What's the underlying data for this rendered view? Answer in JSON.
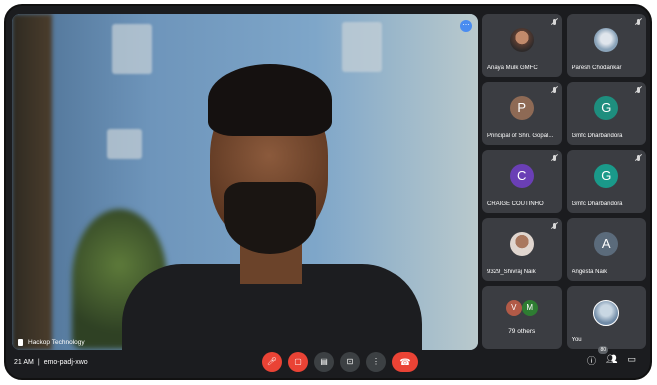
{
  "stage": {
    "presenter_name": "Hackop Technology",
    "more_icon": "more-icon"
  },
  "tiles": [
    {
      "name": "Anaya Mulk GMFC",
      "avatar_type": "photo"
    },
    {
      "name": "Paresh Chodankar",
      "avatar_type": "photo2"
    },
    {
      "name": "Principal of Shri. Gopal...",
      "avatar_type": "letter",
      "letter": "P",
      "color": "#8e6a55"
    },
    {
      "name": "Gmfc Dharbandora",
      "avatar_type": "letter",
      "letter": "G",
      "color": "#1e8e7e"
    },
    {
      "name": "CRAIGE COUTINHO",
      "avatar_type": "letter",
      "letter": "C",
      "color": "#6a3fb5"
    },
    {
      "name": "Gmfc Dharbandora",
      "avatar_type": "letter",
      "letter": "G",
      "color": "#1a9a8a"
    },
    {
      "name": "9329_Shivraj Naik",
      "avatar_type": "photo3"
    },
    {
      "name": "Angesta Naik",
      "avatar_type": "letter",
      "letter": "A",
      "color": "#5b6b7b"
    },
    {
      "name": "You",
      "avatar_type": "photo4"
    }
  ],
  "others": {
    "label": "79 others",
    "letters": [
      "V",
      "M"
    ],
    "colors": [
      "#b15a47",
      "#2e7d32"
    ]
  },
  "bottom_bar": {
    "time": "21 AM",
    "separator": "|",
    "meeting_code": "emo-padj-xwo",
    "badge_count": "80"
  }
}
